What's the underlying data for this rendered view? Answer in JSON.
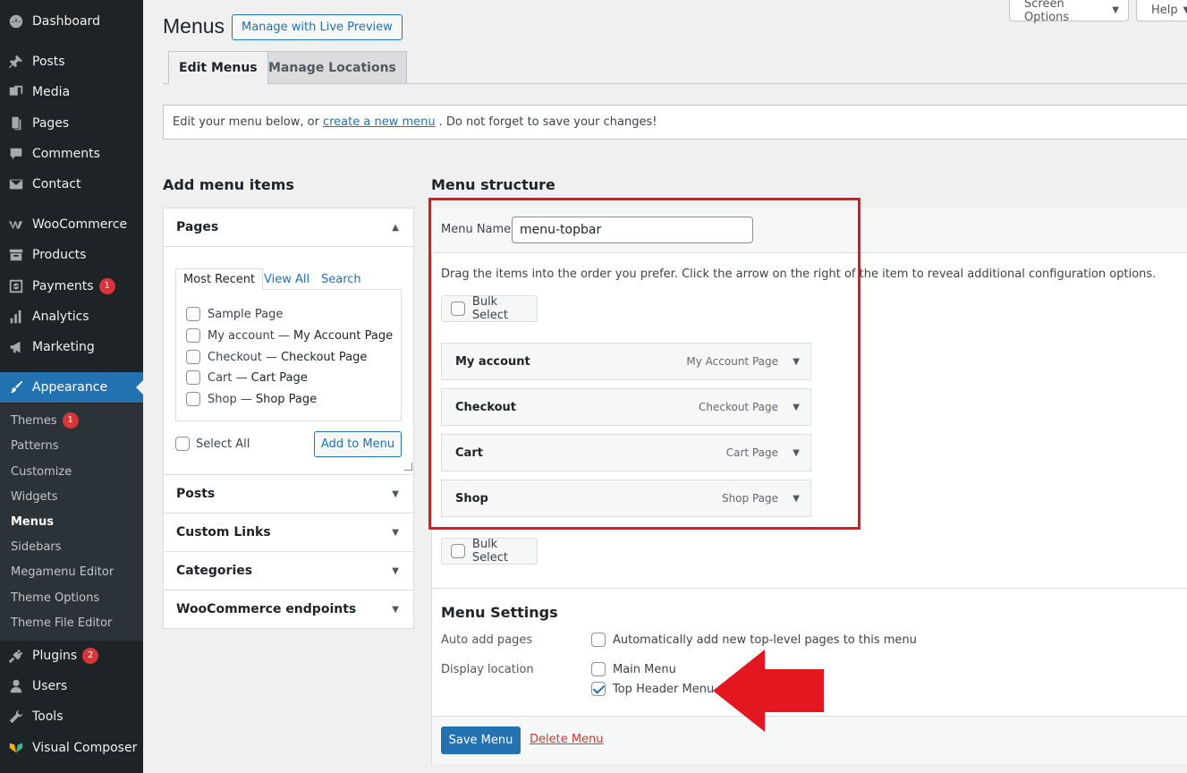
{
  "sidebar": {
    "items": [
      {
        "label": "Dashboard",
        "icon": "dashboard-icon"
      },
      {
        "label": "Posts",
        "icon": "pin-icon"
      },
      {
        "label": "Media",
        "icon": "media-icon"
      },
      {
        "label": "Pages",
        "icon": "pages-icon"
      },
      {
        "label": "Comments",
        "icon": "comment-icon"
      },
      {
        "label": "Contact",
        "icon": "mail-icon"
      },
      {
        "label": "WooCommerce",
        "icon": "woocommerce-icon"
      },
      {
        "label": "Products",
        "icon": "archive-icon"
      },
      {
        "label": "Payments",
        "icon": "payments-icon",
        "badge": "1"
      },
      {
        "label": "Analytics",
        "icon": "bar-chart-icon"
      },
      {
        "label": "Marketing",
        "icon": "megaphone-icon"
      },
      {
        "label": "Appearance",
        "icon": "brush-icon"
      },
      {
        "label": "Plugins",
        "icon": "plugin-icon",
        "badge": "2"
      },
      {
        "label": "Users",
        "icon": "users-icon"
      },
      {
        "label": "Tools",
        "icon": "wrench-icon"
      },
      {
        "label": "Visual Composer",
        "icon": "visual-composer-icon"
      }
    ],
    "submenu": [
      {
        "label": "Themes",
        "badge": "1"
      },
      {
        "label": "Patterns"
      },
      {
        "label": "Customize"
      },
      {
        "label": "Widgets"
      },
      {
        "label": "Menus"
      },
      {
        "label": "Sidebars"
      },
      {
        "label": "Megamenu Editor"
      },
      {
        "label": "Theme Options"
      },
      {
        "label": "Theme File Editor"
      }
    ]
  },
  "top": {
    "screen_options": "Screen Options",
    "help": "Help"
  },
  "header": {
    "title": "Menus",
    "live_preview": "Manage with Live Preview",
    "tabs": [
      "Edit Menus",
      "Manage Locations"
    ]
  },
  "notice": {
    "before": "Edit your menu below, or",
    "link": "create a new menu",
    "after": ". Do not forget to save your changes!"
  },
  "add_items": {
    "heading": "Add menu items",
    "pages_heading": "Pages",
    "inner_tabs": [
      "Most Recent",
      "View All",
      "Search"
    ],
    "pages": [
      {
        "plain": "Sample Page",
        "bold": ""
      },
      {
        "plain": "My account — ",
        "bold": "My Account Page"
      },
      {
        "plain": "Checkout — ",
        "bold": "Checkout Page"
      },
      {
        "plain": "Cart — ",
        "bold": "Cart Page"
      },
      {
        "plain": "Shop — ",
        "bold": "Shop Page"
      }
    ],
    "select_all": "Select All",
    "add_button": "Add to Menu",
    "other_sections": [
      "Posts",
      "Custom Links",
      "Categories",
      "WooCommerce endpoints"
    ]
  },
  "menu_structure": {
    "heading": "Menu structure",
    "name_label": "Menu Name",
    "name_value": "menu-topbar",
    "instructions": "Drag the items into the order you prefer. Click the arrow on the right of the item to reveal additional configuration options.",
    "bulk_select": "Bulk Select",
    "items": [
      {
        "title": "My account",
        "type": "My Account Page"
      },
      {
        "title": "Checkout",
        "type": "Checkout Page"
      },
      {
        "title": "Cart",
        "type": "Cart Page"
      },
      {
        "title": "Shop",
        "type": "Shop Page"
      }
    ]
  },
  "menu_settings": {
    "heading": "Menu Settings",
    "auto_add_label": "Auto add pages",
    "auto_add_option": "Automatically add new top-level pages to this menu",
    "display_label": "Display location",
    "locations": [
      {
        "label": "Main Menu",
        "checked": false
      },
      {
        "label": "Top Header Menu",
        "checked": true
      }
    ]
  },
  "footer": {
    "save": "Save Menu",
    "delete": "Delete Menu"
  },
  "colors": {
    "accent": "#2271b1",
    "sidebar_bg": "#1d2327",
    "highlight_red": "#e3171f",
    "delete_red": "#d63638"
  }
}
